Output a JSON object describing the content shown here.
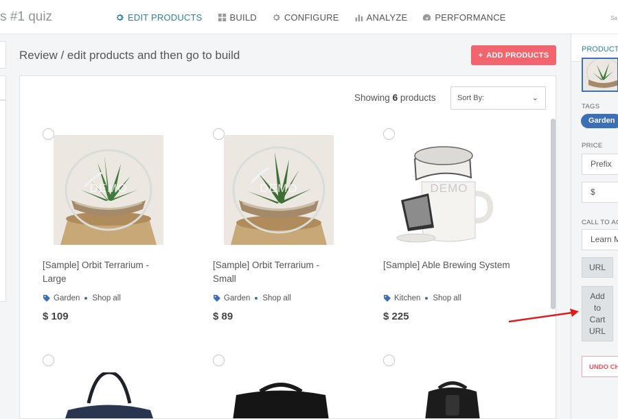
{
  "app_title": "s #1 quiz",
  "nav": [
    {
      "label": "EDIT PRODUCTS",
      "icon": "gear-icon",
      "active": true
    },
    {
      "label": "BUILD",
      "icon": "grid-icon",
      "active": false
    },
    {
      "label": "CONFIGURE",
      "icon": "gear-icon",
      "active": false
    },
    {
      "label": "ANALYZE",
      "icon": "bar-chart-icon",
      "active": false
    },
    {
      "label": "PERFORMANCE",
      "icon": "speedometer-icon",
      "active": false
    }
  ],
  "saved_label": "Sa",
  "page_heading": "Review / edit products and then go to build",
  "add_products_label": "ADD PRODUCTS",
  "showing": {
    "prefix": "Showing",
    "count": "6",
    "suffix": "products"
  },
  "sort_label": "Sort By:",
  "products": [
    {
      "name": "[Sample] Orbit Terrarium - Large",
      "tag": "Garden",
      "category": "Shop all",
      "price": "$ 109",
      "watermark": "DEMO"
    },
    {
      "name": "[Sample] Orbit Terrarium - Small",
      "tag": "Garden",
      "category": "Shop all",
      "price": "$ 89",
      "watermark": "DEMO"
    },
    {
      "name": "[Sample] Able Brewing System",
      "tag": "Kitchen",
      "category": "Shop all",
      "price": "$ 225",
      "watermark": "DEMO"
    }
  ],
  "right_panel": {
    "header": "PRODUCT",
    "tags_label": "TAGS",
    "tag": "Garden",
    "price_label": "PRICE",
    "price_prefix": "Prefix",
    "currency": "$",
    "cta_label": "CALL TO AC",
    "cta_value": "Learn M",
    "url_button": "URL",
    "cart_url_button": "Add to Cart URL",
    "undo_label": "UNDO CH"
  },
  "colors": {
    "accent": "#2f7ea0",
    "add_button": "#f2646e",
    "tag": "#3b6fb6",
    "arrow": "#e01b1b"
  }
}
